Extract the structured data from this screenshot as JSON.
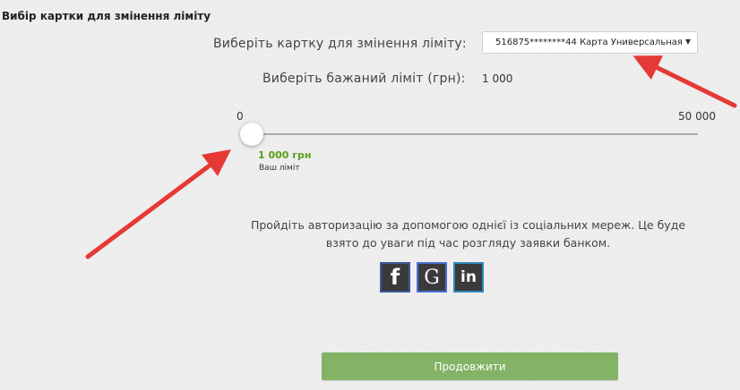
{
  "section": {
    "title": "Вибір картки для змінення ліміту"
  },
  "card": {
    "label": "Виберіть картку для змінення ліміту:",
    "selected": "516875********44 Карта Универсальная"
  },
  "limit": {
    "label": "Виберіть бажаний ліміт (грн):",
    "value": "1 000"
  },
  "slider": {
    "min_label": "0",
    "max_label": "50 000",
    "current_label": "1 000 грн",
    "caption": "Ваш ліміт",
    "min": 0,
    "max": 50000,
    "current": 1000
  },
  "auth": {
    "text": "Пройдіть авторизацію за допомогою однієї із соціальних мереж. Це буде взято до уваги під час розгляду заявки банком."
  },
  "social": [
    {
      "glyph": "f",
      "icon": "facebook-icon"
    },
    {
      "glyph": "G",
      "icon": "google-icon"
    },
    {
      "glyph": "in",
      "icon": "linkedin-icon"
    }
  ],
  "continue_label": "Продовжити",
  "colors": {
    "accent_green": "#82b366",
    "value_green": "#5a9e1a",
    "annotation_red": "#e53935"
  }
}
